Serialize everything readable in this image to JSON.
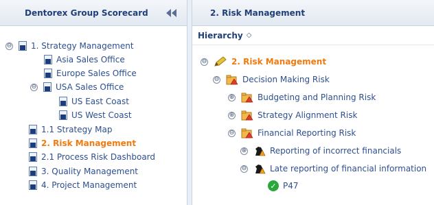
{
  "left": {
    "header": "Dentorex Group Scorecard",
    "items": [
      {
        "label": "1. Strategy Management"
      },
      {
        "label": "Asia Sales Office"
      },
      {
        "label": "Europe Sales Office"
      },
      {
        "label": "USA Sales Office"
      },
      {
        "label": "US East Coast"
      },
      {
        "label": "US West Coast"
      },
      {
        "label": "1.1 Strategy Map"
      },
      {
        "label": "2. Risk Management"
      },
      {
        "label": "2.1 Process Risk Dashboard"
      },
      {
        "label": "3. Quality Management"
      },
      {
        "label": "4. Project Management"
      }
    ]
  },
  "right": {
    "header": "2. Risk Management",
    "column_header": "Hierarchy",
    "rows": [
      {
        "label": "2. Risk Management"
      },
      {
        "label": "Decision Making Risk"
      },
      {
        "label": "Budgeting and Planning Risk"
      },
      {
        "label": "Strategy Alignment Risk"
      },
      {
        "label": "Financial Reporting Risk"
      },
      {
        "label": "Reporting of incorrect financials"
      },
      {
        "label": "Late reporting of financial information"
      },
      {
        "label": "P47"
      }
    ]
  },
  "glyphs": {
    "expanded": "⊖",
    "collapsed": "⊕",
    "sort": "◇",
    "check": "✓"
  },
  "colors": {
    "accent": "#f07a10",
    "link": "#2d4f8f",
    "header_text": "#1f3f78",
    "ok": "#2aa83a"
  }
}
